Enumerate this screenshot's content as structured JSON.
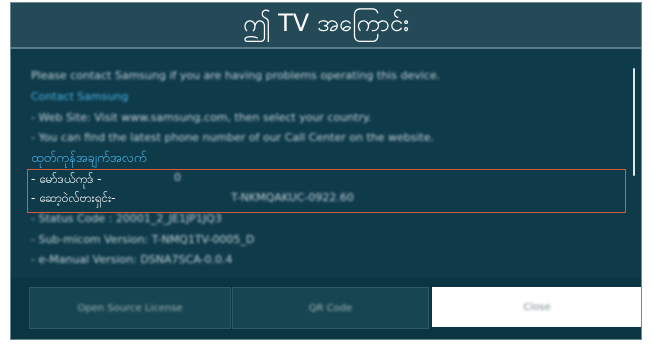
{
  "dialog": {
    "title": "ဤ TV အကြောင်း",
    "lines": [
      "Please contact Samsung if you are having problems operating this device.",
      "Contact Samsung",
      "- Web Site: Visit www.samsung.com, then select your country.",
      "- You can find the latest phone number of our Call Center on the website.",
      "ထုတ်ကုန်အချက်အလက်",
      "- မော်ဒယ်ကုဒ် -",
      "- ဆော့ဝဲလ်ဗားရှင်း-",
      "- Status Code : 20001_2_JE1JP1JQ3",
      "- Sub-micom Version: T-NMQ1TV-0005_D",
      "- e-Manual Version: DSNA7SCA-0.0.4"
    ],
    "model_value": "0",
    "software_value": "T-NKMQAKUC-0922.60",
    "buttons": [
      "Open Source License",
      "QR Code",
      "Close"
    ]
  },
  "colors": {
    "background": "#0e3a4a",
    "title_bar": "#244a58",
    "accent": "#4bb3e6",
    "highlight_border": "#d85a39",
    "selected_button": "#ffffff"
  }
}
